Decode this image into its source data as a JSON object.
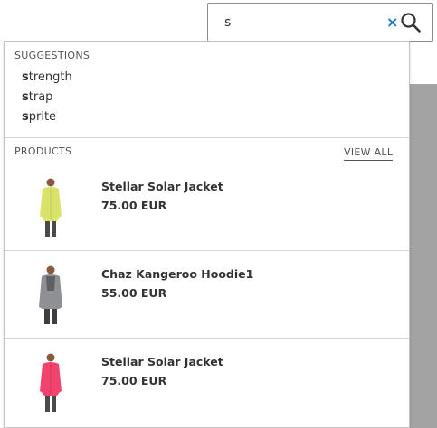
{
  "search": {
    "value": "s",
    "clear_symbol": "×",
    "clear_icon": "close-icon",
    "search_icon": "search-icon"
  },
  "suggestions": {
    "title": "SUGGESTIONS",
    "items": [
      {
        "match": "s",
        "rest": "trength"
      },
      {
        "match": "s",
        "rest": "trap"
      },
      {
        "match": "s",
        "rest": "prite"
      }
    ]
  },
  "products": {
    "title": "PRODUCTS",
    "view_all": "VIEW ALL",
    "items": [
      {
        "name": "Stellar Solar Jacket",
        "price": "75.00 EUR",
        "color": "#d9e36a"
      },
      {
        "name": "Chaz Kangeroo Hoodie1",
        "price": "55.00 EUR",
        "color": "#8e9093"
      },
      {
        "name": "Stellar Solar Jacket",
        "price": "75.00 EUR",
        "color": "#f0446e"
      }
    ]
  },
  "colors": {
    "accent": "#1979c3",
    "overlay_background": "#a3a3a3"
  }
}
